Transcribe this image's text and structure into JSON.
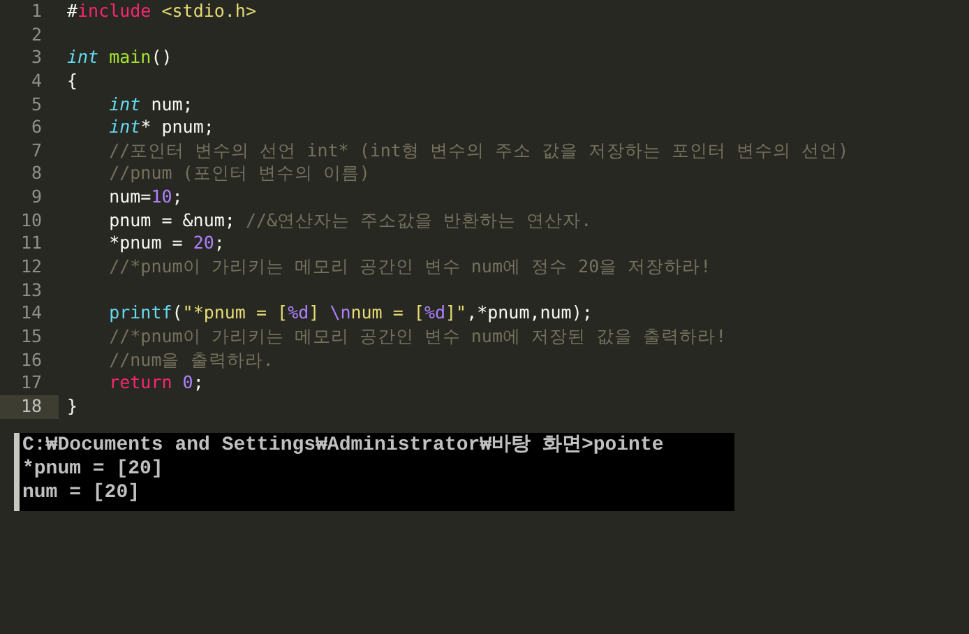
{
  "editor": {
    "lines": [
      {
        "number": "1",
        "current": false,
        "tokens": [
          {
            "kind": "plain",
            "text": "#"
          },
          {
            "kind": "keyword",
            "text": "include "
          },
          {
            "kind": "string",
            "text": "<stdio.h>"
          }
        ]
      },
      {
        "number": "2",
        "current": false
      },
      {
        "number": "3",
        "current": false,
        "tokens": [
          {
            "kind": "type",
            "text": "int "
          },
          {
            "kind": "function",
            "text": "main"
          },
          {
            "kind": "plain",
            "text": "()"
          }
        ]
      },
      {
        "number": "4",
        "current": false,
        "tokens": [
          {
            "kind": "plain",
            "text": "{"
          }
        ]
      },
      {
        "number": "5",
        "current": false,
        "tokens": [
          {
            "kind": "type",
            "text": "    int "
          },
          {
            "kind": "plain",
            "text": "num;"
          }
        ]
      },
      {
        "number": "6",
        "current": false,
        "tokens": [
          {
            "kind": "type",
            "text": "    int"
          },
          {
            "kind": "plain",
            "text": "* pnum;"
          }
        ]
      },
      {
        "number": "7",
        "current": false,
        "tokens": [
          {
            "kind": "comment",
            "text": "    //포인터 변수의 선언 int* (int형 변수의 주소 값을 저장하는 포인터 변수의 선언)"
          }
        ]
      },
      {
        "number": "8",
        "current": false,
        "tokens": [
          {
            "kind": "comment",
            "text": "    //pnum (포인터 변수의 이름)"
          }
        ]
      },
      {
        "number": "9",
        "current": false,
        "tokens": [
          {
            "kind": "plain",
            "text": "    num="
          },
          {
            "kind": "number",
            "text": "10"
          },
          {
            "kind": "plain",
            "text": ";"
          }
        ]
      },
      {
        "number": "10",
        "current": false,
        "tokens": [
          {
            "kind": "plain",
            "text": "    pnum = &num; "
          },
          {
            "kind": "comment",
            "text": "//&연산자는 주소값을 반환하는 연산자."
          }
        ]
      },
      {
        "number": "11",
        "current": false,
        "tokens": [
          {
            "kind": "plain",
            "text": "    *pnum = "
          },
          {
            "kind": "number",
            "text": "20"
          },
          {
            "kind": "plain",
            "text": ";"
          }
        ]
      },
      {
        "number": "12",
        "current": false,
        "tokens": [
          {
            "kind": "comment",
            "text": "    //*pnum이 가리키는 메모리 공간인 변수 num에 정수 20을 저장하라!"
          }
        ]
      },
      {
        "number": "13",
        "current": false
      },
      {
        "number": "14",
        "current": false,
        "tokens": [
          {
            "kind": "builtin",
            "text": "    printf"
          },
          {
            "kind": "plain",
            "text": "("
          },
          {
            "kind": "string",
            "text": "\"*pnum = ["
          },
          {
            "kind": "number",
            "text": "%d"
          },
          {
            "kind": "string",
            "text": "] "
          },
          {
            "kind": "escape",
            "text": "\\n"
          },
          {
            "kind": "string",
            "text": "num = ["
          },
          {
            "kind": "number",
            "text": "%d"
          },
          {
            "kind": "string",
            "text": "]\""
          },
          {
            "kind": "plain",
            "text": ",*pnum,num);"
          }
        ]
      },
      {
        "number": "15",
        "current": false,
        "tokens": [
          {
            "kind": "comment",
            "text": "    //*pnum이 가리키는 메모리 공간인 변수 num에 저장된 값을 출력하라!"
          }
        ]
      },
      {
        "number": "16",
        "current": false,
        "tokens": [
          {
            "kind": "comment",
            "text": "    //num을 출력하라."
          }
        ]
      },
      {
        "number": "17",
        "current": false,
        "tokens": [
          {
            "kind": "keyword",
            "text": "    return "
          },
          {
            "kind": "number",
            "text": "0"
          },
          {
            "kind": "plain",
            "text": ";"
          }
        ]
      },
      {
        "number": "18",
        "current": true,
        "tokens": [
          {
            "kind": "plain",
            "text": "}"
          }
        ]
      }
    ]
  },
  "console": {
    "lines": [
      "C:₩Documents and Settings₩Administrator₩바탕 화면>pointe",
      "*pnum = [20]",
      "num = [20]"
    ]
  }
}
